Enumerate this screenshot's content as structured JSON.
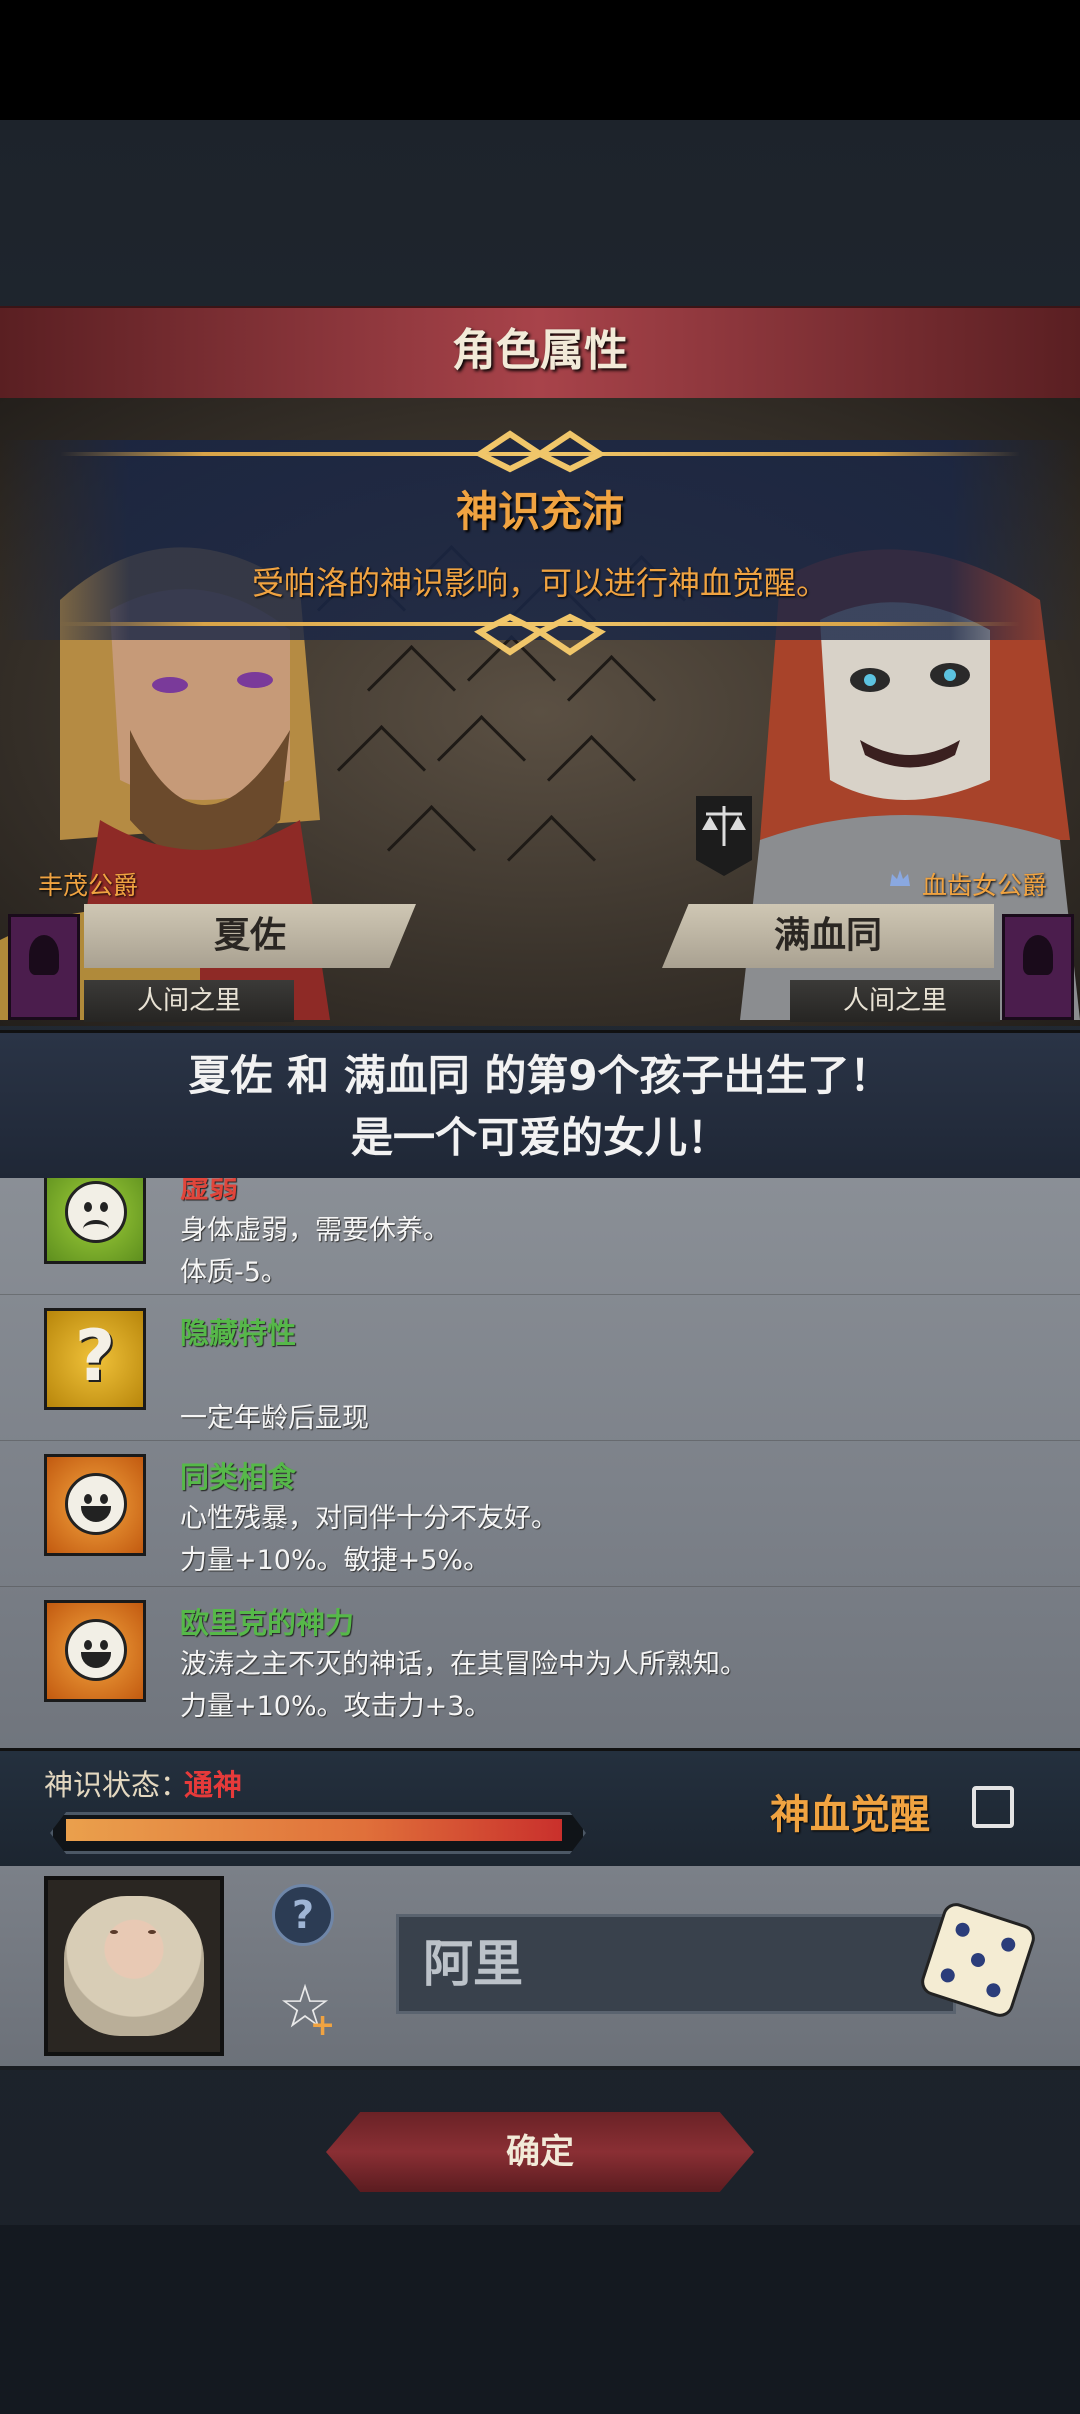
{
  "header": {
    "title": "角色属性"
  },
  "event": {
    "title": "神识充沛",
    "description": "受帕洛的神识影响，可以进行神血觉醒。"
  },
  "parents": {
    "left": {
      "house": "丰茂公爵",
      "name": "夏佐",
      "realm": "人间之里"
    },
    "right": {
      "house": "血齿女公爵",
      "name": "满血同",
      "realm": "人间之里"
    }
  },
  "announcement": {
    "line1": "夏佐 和 满血同 的第9个孩子出生了！",
    "line2": "是一个可爱的女儿！"
  },
  "traits": [
    {
      "name": "虚弱",
      "name_color": "#e0453b",
      "icon": "sad-face-icon",
      "lines": [
        "身体虚弱，需要休养。",
        "体质-5。"
      ]
    },
    {
      "name": "隐藏特性",
      "name_color": "#56b849",
      "icon": "question-mark-icon",
      "lines": [
        "",
        "一定年龄后显现"
      ]
    },
    {
      "name": "同类相食",
      "name_color": "#56b849",
      "icon": "happy-face-icon",
      "lines": [
        "心性残暴，对同伴十分不友好。",
        "力量+10%。敏捷+5%。"
      ]
    },
    {
      "name": "欧里克的神力",
      "name_color": "#56b849",
      "icon": "happy-face-icon",
      "lines": [
        "波涛之主不灭的神话，在其冒险中为人所熟知。",
        "力量+10%。攻击力+3。"
      ]
    }
  ],
  "divine_status": {
    "label": "神识状态：",
    "value": "通神",
    "progress": 1.0,
    "awaken_label": "神血觉醒",
    "awaken_checked": false
  },
  "child": {
    "name": "阿里",
    "help_glyph": "?",
    "star_glyph": "☆",
    "plus_glyph": "+"
  },
  "confirm": {
    "label": "确定"
  },
  "colors": {
    "accent_orange": "#f0a341",
    "danger_red": "#e63a3a",
    "trait_green": "#56b849",
    "title_red": "#a8434a"
  }
}
